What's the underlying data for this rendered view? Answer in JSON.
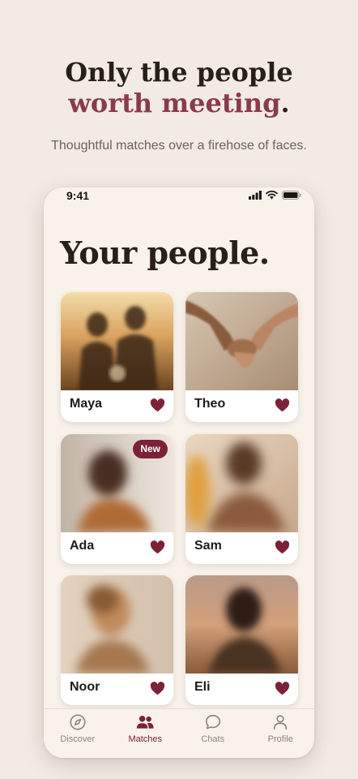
{
  "hero": {
    "line1": "Only the people",
    "line2": "worth meeting",
    "period": ".",
    "subtitle": "Thoughtful matches over a firehose of faces."
  },
  "status_bar": {
    "time": "9:41"
  },
  "screen_title": "Your people.",
  "matches": [
    {
      "name": "Maya",
      "photo": "sunset couple silhouette",
      "liked": true,
      "badge": ""
    },
    {
      "name": "Theo",
      "photo": "holding hands",
      "liked": true,
      "badge": ""
    },
    {
      "name": "Ada",
      "photo": "blurred portrait",
      "liked": true,
      "badge": "New"
    },
    {
      "name": "Sam",
      "photo": "blurred portrait",
      "liked": true,
      "badge": ""
    },
    {
      "name": "Noor",
      "photo": "blurred portrait",
      "liked": true,
      "badge": ""
    },
    {
      "name": "Eli",
      "photo": "blurred portrait",
      "liked": true,
      "badge": ""
    }
  ],
  "tabs": [
    {
      "label": "Discover",
      "icon": "compass-icon",
      "active": false
    },
    {
      "label": "Matches",
      "icon": "people-icon",
      "active": true
    },
    {
      "label": "Chats",
      "icon": "chat-bubble-icon",
      "active": false
    },
    {
      "label": "Profile",
      "icon": "person-icon",
      "active": false
    }
  ],
  "colors": {
    "background": "#f1ebe3",
    "accent": "#7c2138",
    "headline_accent": "#8a3a4a",
    "heart": "#7c2138",
    "text_dark": "#2a1e1a"
  }
}
